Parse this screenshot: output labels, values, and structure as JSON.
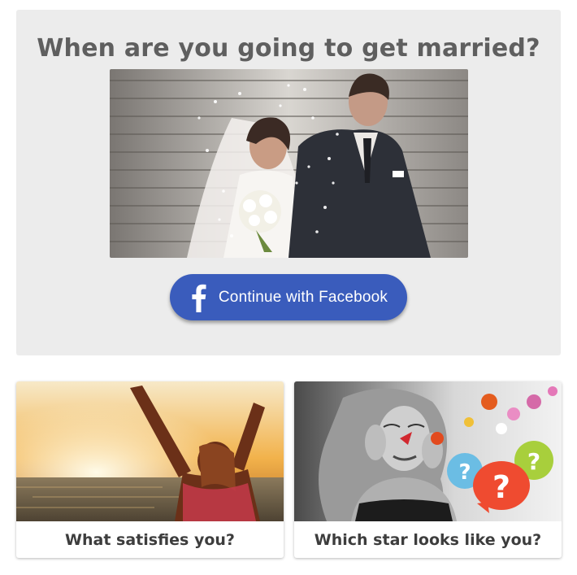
{
  "hero": {
    "title": "When are you going to get married?",
    "image_alt": "wedding-couple-photo",
    "button_label": "Continue with Facebook",
    "button_color": "#3a5cbc"
  },
  "cards": [
    {
      "title": "What satisfies you?",
      "image_alt": "woman-arms-raised-sunset-photo"
    },
    {
      "title": "Which star looks like you?",
      "image_alt": "woman-with-question-bubbles-photo"
    }
  ],
  "colors": {
    "hero_background": "#ececec",
    "title_text": "#5f5f5f",
    "caption_text": "#3d3d3d"
  }
}
